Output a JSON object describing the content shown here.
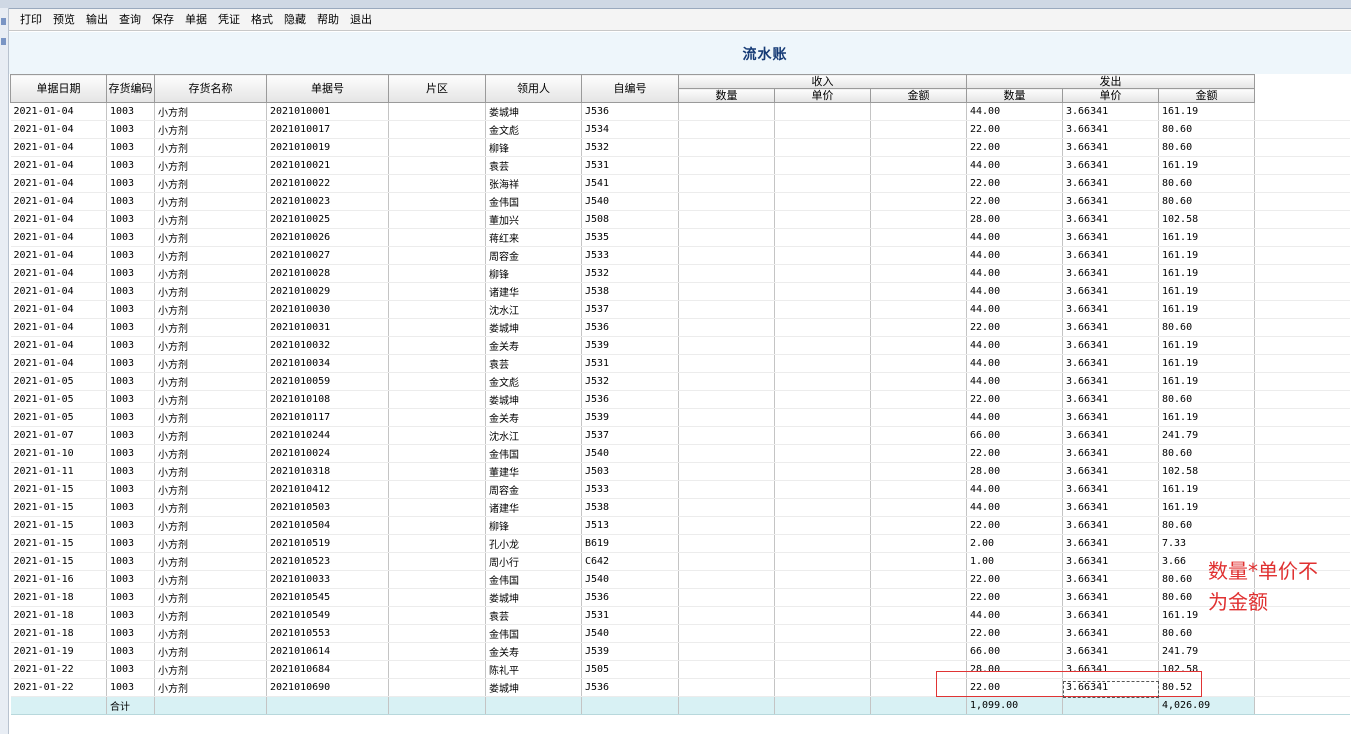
{
  "menu": [
    "打印",
    "预览",
    "输出",
    "查询",
    "保存",
    "单据",
    "凭证",
    "格式",
    "隐藏",
    "帮助",
    "退出"
  ],
  "title": "流水账",
  "headers": {
    "date": "单据日期",
    "code": "存货编码",
    "name": "存货名称",
    "doc": "单据号",
    "area": "片区",
    "receiver": "领用人",
    "selfno": "自编号",
    "in": "收入",
    "out": "发出",
    "qty": "数量",
    "price": "单价",
    "amount": "金额"
  },
  "rows": [
    {
      "date": "2021-01-04",
      "code": "1003",
      "name": "小方剂",
      "doc": "2021010001",
      "area": "",
      "receiver": "娄城坤",
      "selfno": "J536",
      "in_qty": "",
      "in_price": "",
      "in_amount": "",
      "out_qty": "44.00",
      "out_price": "3.66341",
      "out_amount": "161.19"
    },
    {
      "date": "2021-01-04",
      "code": "1003",
      "name": "小方剂",
      "doc": "2021010017",
      "area": "",
      "receiver": "金文彪",
      "selfno": "J534",
      "in_qty": "",
      "in_price": "",
      "in_amount": "",
      "out_qty": "22.00",
      "out_price": "3.66341",
      "out_amount": "80.60"
    },
    {
      "date": "2021-01-04",
      "code": "1003",
      "name": "小方剂",
      "doc": "2021010019",
      "area": "",
      "receiver": "柳锋",
      "selfno": "J532",
      "in_qty": "",
      "in_price": "",
      "in_amount": "",
      "out_qty": "22.00",
      "out_price": "3.66341",
      "out_amount": "80.60"
    },
    {
      "date": "2021-01-04",
      "code": "1003",
      "name": "小方剂",
      "doc": "2021010021",
      "area": "",
      "receiver": "袁芸",
      "selfno": "J531",
      "in_qty": "",
      "in_price": "",
      "in_amount": "",
      "out_qty": "44.00",
      "out_price": "3.66341",
      "out_amount": "161.19"
    },
    {
      "date": "2021-01-04",
      "code": "1003",
      "name": "小方剂",
      "doc": "2021010022",
      "area": "",
      "receiver": "张海祥",
      "selfno": "J541",
      "in_qty": "",
      "in_price": "",
      "in_amount": "",
      "out_qty": "22.00",
      "out_price": "3.66341",
      "out_amount": "80.60"
    },
    {
      "date": "2021-01-04",
      "code": "1003",
      "name": "小方剂",
      "doc": "2021010023",
      "area": "",
      "receiver": "金伟国",
      "selfno": "J540",
      "in_qty": "",
      "in_price": "",
      "in_amount": "",
      "out_qty": "22.00",
      "out_price": "3.66341",
      "out_amount": "80.60"
    },
    {
      "date": "2021-01-04",
      "code": "1003",
      "name": "小方剂",
      "doc": "2021010025",
      "area": "",
      "receiver": "董加兴",
      "selfno": "J508",
      "in_qty": "",
      "in_price": "",
      "in_amount": "",
      "out_qty": "28.00",
      "out_price": "3.66341",
      "out_amount": "102.58"
    },
    {
      "date": "2021-01-04",
      "code": "1003",
      "name": "小方剂",
      "doc": "2021010026",
      "area": "",
      "receiver": "蒋红来",
      "selfno": "J535",
      "in_qty": "",
      "in_price": "",
      "in_amount": "",
      "out_qty": "44.00",
      "out_price": "3.66341",
      "out_amount": "161.19"
    },
    {
      "date": "2021-01-04",
      "code": "1003",
      "name": "小方剂",
      "doc": "2021010027",
      "area": "",
      "receiver": "周容金",
      "selfno": "J533",
      "in_qty": "",
      "in_price": "",
      "in_amount": "",
      "out_qty": "44.00",
      "out_price": "3.66341",
      "out_amount": "161.19"
    },
    {
      "date": "2021-01-04",
      "code": "1003",
      "name": "小方剂",
      "doc": "2021010028",
      "area": "",
      "receiver": "柳锋",
      "selfno": "J532",
      "in_qty": "",
      "in_price": "",
      "in_amount": "",
      "out_qty": "44.00",
      "out_price": "3.66341",
      "out_amount": "161.19"
    },
    {
      "date": "2021-01-04",
      "code": "1003",
      "name": "小方剂",
      "doc": "2021010029",
      "area": "",
      "receiver": "诸建华",
      "selfno": "J538",
      "in_qty": "",
      "in_price": "",
      "in_amount": "",
      "out_qty": "44.00",
      "out_price": "3.66341",
      "out_amount": "161.19"
    },
    {
      "date": "2021-01-04",
      "code": "1003",
      "name": "小方剂",
      "doc": "2021010030",
      "area": "",
      "receiver": "沈水江",
      "selfno": "J537",
      "in_qty": "",
      "in_price": "",
      "in_amount": "",
      "out_qty": "44.00",
      "out_price": "3.66341",
      "out_amount": "161.19"
    },
    {
      "date": "2021-01-04",
      "code": "1003",
      "name": "小方剂",
      "doc": "2021010031",
      "area": "",
      "receiver": "娄城坤",
      "selfno": "J536",
      "in_qty": "",
      "in_price": "",
      "in_amount": "",
      "out_qty": "22.00",
      "out_price": "3.66341",
      "out_amount": "80.60"
    },
    {
      "date": "2021-01-04",
      "code": "1003",
      "name": "小方剂",
      "doc": "2021010032",
      "area": "",
      "receiver": "金关寿",
      "selfno": "J539",
      "in_qty": "",
      "in_price": "",
      "in_amount": "",
      "out_qty": "44.00",
      "out_price": "3.66341",
      "out_amount": "161.19"
    },
    {
      "date": "2021-01-04",
      "code": "1003",
      "name": "小方剂",
      "doc": "2021010034",
      "area": "",
      "receiver": "袁芸",
      "selfno": "J531",
      "in_qty": "",
      "in_price": "",
      "in_amount": "",
      "out_qty": "44.00",
      "out_price": "3.66341",
      "out_amount": "161.19"
    },
    {
      "date": "2021-01-05",
      "code": "1003",
      "name": "小方剂",
      "doc": "2021010059",
      "area": "",
      "receiver": "金文彪",
      "selfno": "J532",
      "in_qty": "",
      "in_price": "",
      "in_amount": "",
      "out_qty": "44.00",
      "out_price": "3.66341",
      "out_amount": "161.19"
    },
    {
      "date": "2021-01-05",
      "code": "1003",
      "name": "小方剂",
      "doc": "2021010108",
      "area": "",
      "receiver": "娄城坤",
      "selfno": "J536",
      "in_qty": "",
      "in_price": "",
      "in_amount": "",
      "out_qty": "22.00",
      "out_price": "3.66341",
      "out_amount": "80.60"
    },
    {
      "date": "2021-01-05",
      "code": "1003",
      "name": "小方剂",
      "doc": "2021010117",
      "area": "",
      "receiver": "金关寿",
      "selfno": "J539",
      "in_qty": "",
      "in_price": "",
      "in_amount": "",
      "out_qty": "44.00",
      "out_price": "3.66341",
      "out_amount": "161.19"
    },
    {
      "date": "2021-01-07",
      "code": "1003",
      "name": "小方剂",
      "doc": "2021010244",
      "area": "",
      "receiver": "沈水江",
      "selfno": "J537",
      "in_qty": "",
      "in_price": "",
      "in_amount": "",
      "out_qty": "66.00",
      "out_price": "3.66341",
      "out_amount": "241.79"
    },
    {
      "date": "2021-01-10",
      "code": "1003",
      "name": "小方剂",
      "doc": "2021010024",
      "area": "",
      "receiver": "金伟国",
      "selfno": "J540",
      "in_qty": "",
      "in_price": "",
      "in_amount": "",
      "out_qty": "22.00",
      "out_price": "3.66341",
      "out_amount": "80.60"
    },
    {
      "date": "2021-01-11",
      "code": "1003",
      "name": "小方剂",
      "doc": "2021010318",
      "area": "",
      "receiver": "董建华",
      "selfno": "J503",
      "in_qty": "",
      "in_price": "",
      "in_amount": "",
      "out_qty": "28.00",
      "out_price": "3.66341",
      "out_amount": "102.58"
    },
    {
      "date": "2021-01-15",
      "code": "1003",
      "name": "小方剂",
      "doc": "2021010412",
      "area": "",
      "receiver": "周容金",
      "selfno": "J533",
      "in_qty": "",
      "in_price": "",
      "in_amount": "",
      "out_qty": "44.00",
      "out_price": "3.66341",
      "out_amount": "161.19"
    },
    {
      "date": "2021-01-15",
      "code": "1003",
      "name": "小方剂",
      "doc": "2021010503",
      "area": "",
      "receiver": "诸建华",
      "selfno": "J538",
      "in_qty": "",
      "in_price": "",
      "in_amount": "",
      "out_qty": "44.00",
      "out_price": "3.66341",
      "out_amount": "161.19"
    },
    {
      "date": "2021-01-15",
      "code": "1003",
      "name": "小方剂",
      "doc": "2021010504",
      "area": "",
      "receiver": "柳锋",
      "selfno": "J513",
      "in_qty": "",
      "in_price": "",
      "in_amount": "",
      "out_qty": "22.00",
      "out_price": "3.66341",
      "out_amount": "80.60"
    },
    {
      "date": "2021-01-15",
      "code": "1003",
      "name": "小方剂",
      "doc": "2021010519",
      "area": "",
      "receiver": "孔小龙",
      "selfno": "B619",
      "in_qty": "",
      "in_price": "",
      "in_amount": "",
      "out_qty": "2.00",
      "out_price": "3.66341",
      "out_amount": "7.33"
    },
    {
      "date": "2021-01-15",
      "code": "1003",
      "name": "小方剂",
      "doc": "2021010523",
      "area": "",
      "receiver": "周小行",
      "selfno": "C642",
      "in_qty": "",
      "in_price": "",
      "in_amount": "",
      "out_qty": "1.00",
      "out_price": "3.66341",
      "out_amount": "3.66"
    },
    {
      "date": "2021-01-16",
      "code": "1003",
      "name": "小方剂",
      "doc": "2021010033",
      "area": "",
      "receiver": "金伟国",
      "selfno": "J540",
      "in_qty": "",
      "in_price": "",
      "in_amount": "",
      "out_qty": "22.00",
      "out_price": "3.66341",
      "out_amount": "80.60"
    },
    {
      "date": "2021-01-18",
      "code": "1003",
      "name": "小方剂",
      "doc": "2021010545",
      "area": "",
      "receiver": "娄城坤",
      "selfno": "J536",
      "in_qty": "",
      "in_price": "",
      "in_amount": "",
      "out_qty": "22.00",
      "out_price": "3.66341",
      "out_amount": "80.60"
    },
    {
      "date": "2021-01-18",
      "code": "1003",
      "name": "小方剂",
      "doc": "2021010549",
      "area": "",
      "receiver": "袁芸",
      "selfno": "J531",
      "in_qty": "",
      "in_price": "",
      "in_amount": "",
      "out_qty": "44.00",
      "out_price": "3.66341",
      "out_amount": "161.19"
    },
    {
      "date": "2021-01-18",
      "code": "1003",
      "name": "小方剂",
      "doc": "2021010553",
      "area": "",
      "receiver": "金伟国",
      "selfno": "J540",
      "in_qty": "",
      "in_price": "",
      "in_amount": "",
      "out_qty": "22.00",
      "out_price": "3.66341",
      "out_amount": "80.60"
    },
    {
      "date": "2021-01-19",
      "code": "1003",
      "name": "小方剂",
      "doc": "2021010614",
      "area": "",
      "receiver": "金关寿",
      "selfno": "J539",
      "in_qty": "",
      "in_price": "",
      "in_amount": "",
      "out_qty": "66.00",
      "out_price": "3.66341",
      "out_amount": "241.79"
    },
    {
      "date": "2021-01-22",
      "code": "1003",
      "name": "小方剂",
      "doc": "2021010684",
      "area": "",
      "receiver": "陈礼平",
      "selfno": "J505",
      "in_qty": "",
      "in_price": "",
      "in_amount": "",
      "out_qty": "28.00",
      "out_price": "3.66341",
      "out_amount": "102.58"
    },
    {
      "date": "2021-01-22",
      "code": "1003",
      "name": "小方剂",
      "doc": "2021010690",
      "area": "",
      "receiver": "娄城坤",
      "selfno": "J536",
      "in_qty": "",
      "in_price": "",
      "in_amount": "",
      "out_qty": "22.00",
      "out_price": "3.66341",
      "out_amount": "80.52"
    }
  ],
  "total": {
    "label": "合计",
    "out_qty": "1,099.00",
    "out_amount": "4,026.09"
  },
  "annotation": {
    "line1": "数量*单价不",
    "line2": "为金额"
  },
  "colors": {
    "title": "#153a75",
    "annotation": "#e03131",
    "total_row": "#d8f1f4",
    "header_band": "#eef6fb"
  }
}
